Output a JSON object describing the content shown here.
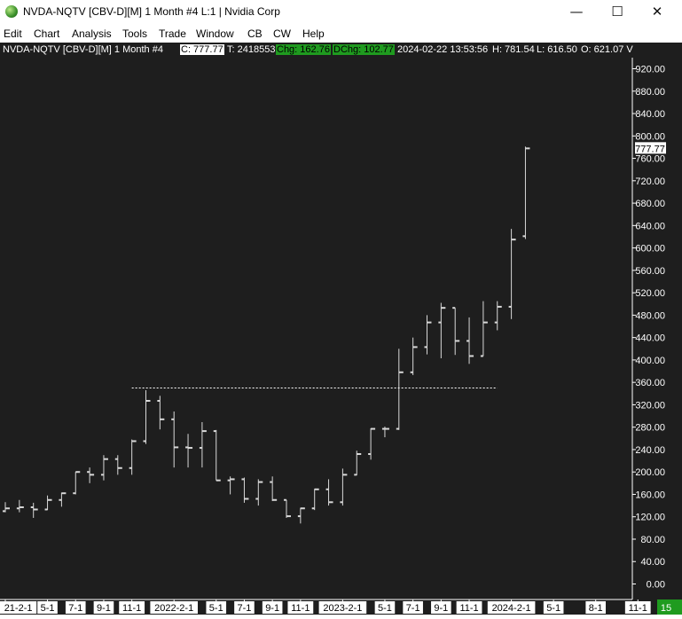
{
  "window": {
    "title": "NVDA-NQTV [CBV-D][M]  1 Month #4 L:1 | Nvidia Corp",
    "minimize_glyph": "—",
    "maximize_glyph": "☐",
    "close_glyph": "✕"
  },
  "menu": [
    "Edit",
    "Chart",
    "Analysis",
    "Tools",
    "Trade",
    "Window",
    "CB",
    "CW",
    "Help"
  ],
  "infobar": {
    "symbol": "NVDA-NQTV [CBV-D][M]  1 Month #4",
    "close": "C: 777.77",
    "ticks": "T: 2418553",
    "chg": "Chg: 162.76",
    "dchg": "DChg: 102.77",
    "datetime": "2024-02-22 13:53:56",
    "high": "H: 781.54",
    "low": "L: 616.50",
    "open": "O: 621.07 V"
  },
  "corner_badge": "15",
  "colors": {
    "background": "#1e1e1e",
    "bars": "#d8d8d8",
    "axis_text": "#ffffff",
    "chg_highlight": "#1f9b1f",
    "dotted_line": "#ffffff"
  },
  "chart_data": {
    "type": "ohlc",
    "title": "NVDA-NQTV [CBV-D][M]  1 Month #4 L:1 | Nvidia Corp",
    "ylim": [
      0,
      950
    ],
    "y_ticks": [
      "0.00",
      "40.00",
      "80.00",
      "120.00",
      "160.00",
      "200.00",
      "240.00",
      "280.00",
      "320.00",
      "360.00",
      "400.00",
      "440.00",
      "480.00",
      "520.00",
      "560.00",
      "600.00",
      "640.00",
      "680.00",
      "720.00",
      "760.00",
      "800.00",
      "840.00",
      "880.00",
      "920.00"
    ],
    "y_tick_values": [
      0,
      40,
      80,
      120,
      160,
      200,
      240,
      280,
      320,
      360,
      400,
      440,
      480,
      520,
      560,
      600,
      640,
      680,
      720,
      760,
      800,
      840,
      880,
      920
    ],
    "x_labels": [
      "21-2-1",
      "5-1",
      "7-1",
      "9-1",
      "11-1",
      "2022-2-1",
      "5-1",
      "7-1",
      "9-1",
      "11-1",
      "2023-2-1",
      "5-1",
      "7-1",
      "9-1",
      "11-1",
      "2024-2-1",
      "5-1",
      "8-1",
      "11-1"
    ],
    "x_label_months": [
      0,
      3,
      5,
      7,
      9,
      12,
      15,
      17,
      19,
      21,
      24,
      27,
      29,
      31,
      33,
      36,
      39,
      42,
      45
    ],
    "last_price_label": "777.77",
    "last_price": 777.77,
    "dotted_level": 350,
    "dotted_start_month": 9,
    "dotted_end_month": 35,
    "bars": [
      {
        "d": "2021-01",
        "o": 130,
        "h": 146,
        "l": 128,
        "c": 135
      },
      {
        "d": "2021-02",
        "o": 135,
        "h": 150,
        "l": 128,
        "c": 137
      },
      {
        "d": "2021-03",
        "o": 137,
        "h": 145,
        "l": 118,
        "c": 133
      },
      {
        "d": "2021-04",
        "o": 133,
        "h": 158,
        "l": 132,
        "c": 150
      },
      {
        "d": "2021-05",
        "o": 150,
        "h": 163,
        "l": 138,
        "c": 162
      },
      {
        "d": "2021-06",
        "o": 162,
        "h": 200,
        "l": 160,
        "c": 200
      },
      {
        "d": "2021-07",
        "o": 200,
        "h": 208,
        "l": 180,
        "c": 195
      },
      {
        "d": "2021-08",
        "o": 195,
        "h": 230,
        "l": 185,
        "c": 223
      },
      {
        "d": "2021-09",
        "o": 223,
        "h": 230,
        "l": 195,
        "c": 207
      },
      {
        "d": "2021-10",
        "o": 207,
        "h": 258,
        "l": 195,
        "c": 255
      },
      {
        "d": "2021-11",
        "o": 255,
        "h": 346,
        "l": 250,
        "c": 327
      },
      {
        "d": "2021-12",
        "o": 327,
        "h": 336,
        "l": 276,
        "c": 294
      },
      {
        "d": "2022-01",
        "o": 294,
        "h": 308,
        "l": 208,
        "c": 244
      },
      {
        "d": "2022-02",
        "o": 244,
        "h": 268,
        "l": 208,
        "c": 243
      },
      {
        "d": "2022-03",
        "o": 243,
        "h": 289,
        "l": 208,
        "c": 273
      },
      {
        "d": "2022-04",
        "o": 273,
        "h": 275,
        "l": 186,
        "c": 185
      },
      {
        "d": "2022-05",
        "o": 185,
        "h": 192,
        "l": 160,
        "c": 187
      },
      {
        "d": "2022-06",
        "o": 187,
        "h": 190,
        "l": 145,
        "c": 152
      },
      {
        "d": "2022-07",
        "o": 152,
        "h": 187,
        "l": 140,
        "c": 182
      },
      {
        "d": "2022-08",
        "o": 182,
        "h": 192,
        "l": 148,
        "c": 150
      },
      {
        "d": "2022-09",
        "o": 150,
        "h": 140,
        "l": 118,
        "c": 121
      },
      {
        "d": "2022-10",
        "o": 121,
        "h": 136,
        "l": 108,
        "c": 135
      },
      {
        "d": "2022-11",
        "o": 135,
        "h": 170,
        "l": 132,
        "c": 169
      },
      {
        "d": "2022-12",
        "o": 169,
        "h": 187,
        "l": 140,
        "c": 146
      },
      {
        "d": "2023-01",
        "o": 146,
        "h": 206,
        "l": 140,
        "c": 195
      },
      {
        "d": "2023-02",
        "o": 195,
        "h": 238,
        "l": 194,
        "c": 232
      },
      {
        "d": "2023-03",
        "o": 232,
        "h": 278,
        "l": 222,
        "c": 277
      },
      {
        "d": "2023-04",
        "o": 277,
        "h": 281,
        "l": 262,
        "c": 277
      },
      {
        "d": "2023-05",
        "o": 277,
        "h": 420,
        "l": 275,
        "c": 378
      },
      {
        "d": "2023-06",
        "o": 378,
        "h": 440,
        "l": 373,
        "c": 423
      },
      {
        "d": "2023-07",
        "o": 423,
        "h": 480,
        "l": 410,
        "c": 467
      },
      {
        "d": "2023-08",
        "o": 467,
        "h": 502,
        "l": 403,
        "c": 493
      },
      {
        "d": "2023-09",
        "o": 493,
        "h": 476,
        "l": 409,
        "c": 434
      },
      {
        "d": "2023-10",
        "o": 434,
        "h": 476,
        "l": 393,
        "c": 407
      },
      {
        "d": "2023-11",
        "o": 407,
        "h": 505,
        "l": 408,
        "c": 467
      },
      {
        "d": "2023-12",
        "o": 467,
        "h": 505,
        "l": 453,
        "c": 495
      },
      {
        "d": "2024-01",
        "o": 495,
        "h": 634,
        "l": 473,
        "c": 615
      },
      {
        "d": "2024-02",
        "o": 621,
        "h": 781,
        "l": 616,
        "c": 777.77
      }
    ]
  }
}
